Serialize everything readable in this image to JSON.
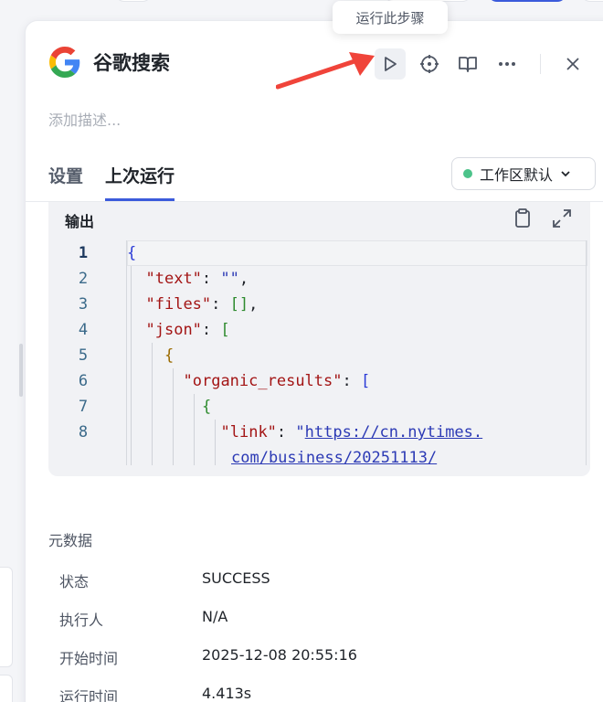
{
  "tooltip": "运行此步骤",
  "node": {
    "title": "谷歌搜索",
    "description_placeholder": "添加描述..."
  },
  "toolbar": {
    "run_icon": "play-icon",
    "locate_icon": "crosshair-icon",
    "docs_icon": "book-icon",
    "more_icon": "more-horizontal-icon",
    "close_icon": "close-icon"
  },
  "tabs": [
    {
      "label": "设置",
      "active": false
    },
    {
      "label": "上次运行",
      "active": true
    }
  ],
  "workspace": {
    "label": "工作区默认",
    "status_color": "#4cc38a"
  },
  "output": {
    "label": "输出",
    "lines": [
      {
        "n": "1",
        "text": "{"
      },
      {
        "n": "2",
        "text": "  \"text\": \"\","
      },
      {
        "n": "3",
        "text": "  \"files\": [],"
      },
      {
        "n": "4",
        "text": "  \"json\": ["
      },
      {
        "n": "5",
        "text": "    {"
      },
      {
        "n": "6",
        "text": "      \"organic_results\": ["
      },
      {
        "n": "7",
        "text": "        {"
      },
      {
        "n": "8",
        "text": "          \"link\": \"https://cn.nytimes."
      },
      {
        "n": "",
        "text": "com/business/20251113/"
      }
    ]
  },
  "metadata": {
    "title": "元数据",
    "rows": [
      {
        "label": "状态",
        "value": "SUCCESS"
      },
      {
        "label": "执行人",
        "value": "N/A"
      },
      {
        "label": "开始时间",
        "value": "2025-12-08 20:55:16"
      },
      {
        "label": "运行时间",
        "value": "4.413s"
      }
    ]
  },
  "colors": {
    "accent": "#3b5bdb",
    "annotation_arrow": "#f0443a"
  }
}
